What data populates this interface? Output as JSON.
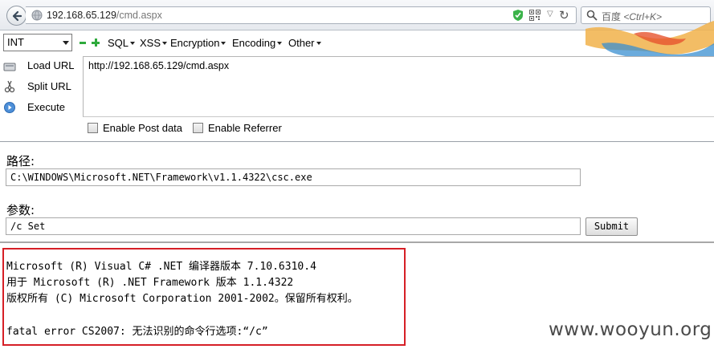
{
  "browser": {
    "url_host": "192.168.65.129",
    "url_path": "/cmd.aspx",
    "search_placeholder_engine": "百度",
    "search_placeholder_shortcut": "<Ctrl+K>"
  },
  "hackbar": {
    "type_select": "INT",
    "menus": [
      "SQL",
      "XSS",
      "Encryption",
      "Encoding",
      "Other"
    ],
    "side_buttons": [
      "Load URL",
      "Split URL",
      "Execute"
    ],
    "url_value": "http://192.168.65.129/cmd.aspx",
    "checkboxes": [
      "Enable Post data",
      "Enable Referrer"
    ]
  },
  "form": {
    "path_label": "路径:",
    "path_value": "C:\\WINDOWS\\Microsoft.NET\\Framework\\v1.1.4322\\csc.exe",
    "args_label": "参数:",
    "args_value": "/c Set",
    "submit_label": "Submit"
  },
  "output": {
    "lines": [
      "Microsoft (R) Visual C# .NET 编译器版本 7.10.6310.4",
      "用于 Microsoft (R) .NET Framework 版本 1.1.4322",
      "版权所有 (C) Microsoft Corporation 2001-2002。保留所有权利。",
      "",
      "fatal error CS2007: 无法识别的命令行选项:“/c”"
    ]
  },
  "watermark": "www.wooyun.org",
  "colors": {
    "output_border": "#d61f26",
    "plus_minus_green": "#2eaa3c"
  }
}
